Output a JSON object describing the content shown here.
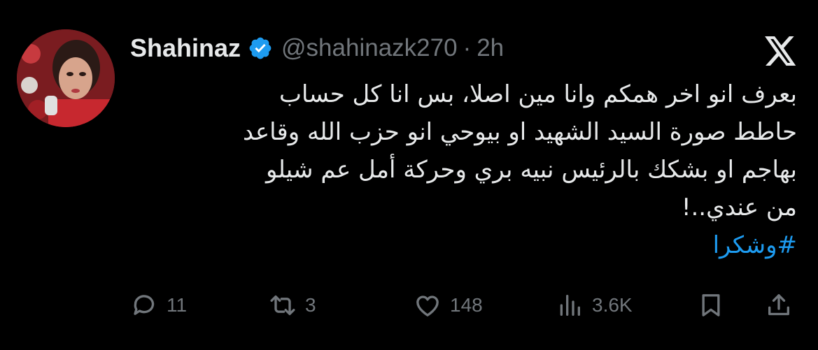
{
  "user": {
    "display_name": "Shahinaz",
    "handle": "@shahinazk270",
    "separator": "·",
    "time": "2h",
    "verified": true,
    "verified_color": "#1d9bf0"
  },
  "tweet": {
    "lines": [
      "بعرف انو اخر همكم وانا مين اصلا، بس انا كل حساب",
      "حاطط صورة السيد الشهيد او بيوحي انو حزب الله وقاعد",
      "بهاجم او بشكك بالرئيس نبيه بري وحركة أمل عم شيلو",
      "من عندي..!"
    ],
    "hashtag": "#وشكرا",
    "hashtag_color": "#1d9bf0"
  },
  "actions": {
    "replies": "11",
    "retweets": "3",
    "likes": "148",
    "views": "3.6K"
  },
  "icons": {
    "logo": "x-logo-icon",
    "reply": "reply-icon",
    "retweet": "retweet-icon",
    "like": "heart-icon",
    "views": "views-chart-icon",
    "bookmark": "bookmark-icon",
    "share": "share-icon"
  },
  "colors": {
    "background": "#000000",
    "text_primary": "#e7e9ea",
    "text_secondary": "#71767b"
  }
}
